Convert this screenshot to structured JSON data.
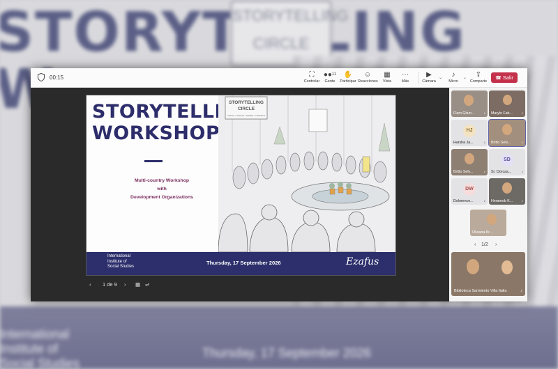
{
  "backdrop": {
    "title_line1": "STORYTELLING",
    "title_line2": "W",
    "sign_line1": "STORYTELLING",
    "sign_line2": "CIRCLE",
    "footer_inst_line1": "International",
    "footer_inst_line2": "Institute of",
    "footer_inst_line3": "Social Studies",
    "footer_date": "Thursday, 17 September 2026"
  },
  "topbar": {
    "timer": "00:15",
    "buttons": [
      {
        "label": "Controlar",
        "icon": "screen-share-icon",
        "glyph": "⛶"
      },
      {
        "label": "Gente",
        "icon": "people-icon",
        "glyph": "👥",
        "badge": "11"
      },
      {
        "label": "Participar",
        "icon": "raise-hand-icon",
        "glyph": "✋"
      },
      {
        "label": "Reacciones",
        "icon": "reactions-icon",
        "glyph": "☺"
      },
      {
        "label": "Vista",
        "icon": "view-icon",
        "glyph": "▦"
      },
      {
        "label": "Más",
        "icon": "more-icon",
        "glyph": "⋯"
      },
      {
        "label": "Cámara",
        "icon": "camera-icon",
        "glyph": "▶"
      },
      {
        "label": "Micro",
        "icon": "microphone-icon",
        "glyph": "🎤"
      },
      {
        "label": "Comparte",
        "icon": "share-icon",
        "glyph": "⇪"
      }
    ],
    "leave_label": "Salir",
    "leave_color": "#c4314b"
  },
  "slide": {
    "title_line1": "STORYTELLING",
    "title_line2": "WORKSHOP",
    "subtitle_line1": "Multi-country Workshop",
    "subtitle_line2": "with",
    "subtitle_line3": "Development Organizations",
    "sign_line1": "STORYTELLING",
    "sign_line2": "CIRCLE",
    "sign_line3": "LISTEN • HONOR • SHARE • CONNECT",
    "institution_line1": "International",
    "institution_line2": "Institute of",
    "institution_line3": "Social Studies",
    "date": "Thursday, 17 September 2026",
    "signature": "Ezafus",
    "brand_color": "#2d2f6c",
    "accent_color": "#7a2c5c"
  },
  "pager": {
    "page_text": "1 de 9"
  },
  "gallery": {
    "tiles": [
      {
        "name": "Flam Gitun...",
        "type": "video"
      },
      {
        "name": "Marylo Fab...",
        "type": "video"
      },
      {
        "name": "Harsha Ja...",
        "type": "avatar",
        "initials": "HJ"
      },
      {
        "name": "Britto Selv...",
        "type": "video"
      },
      {
        "name": "Britto Selv...",
        "type": "video"
      },
      {
        "name": "Sr. Dorcas...",
        "type": "avatar",
        "initials": "SD"
      },
      {
        "name": "Dolorence...",
        "type": "avatar",
        "initials": "DW"
      },
      {
        "name": "Heramob K...",
        "type": "video"
      },
      {
        "name": "Oksana Kr...",
        "type": "video"
      }
    ],
    "page_text": "1/2",
    "big_tile_name": "Biblioteca Sarmiento Villa Italia"
  }
}
